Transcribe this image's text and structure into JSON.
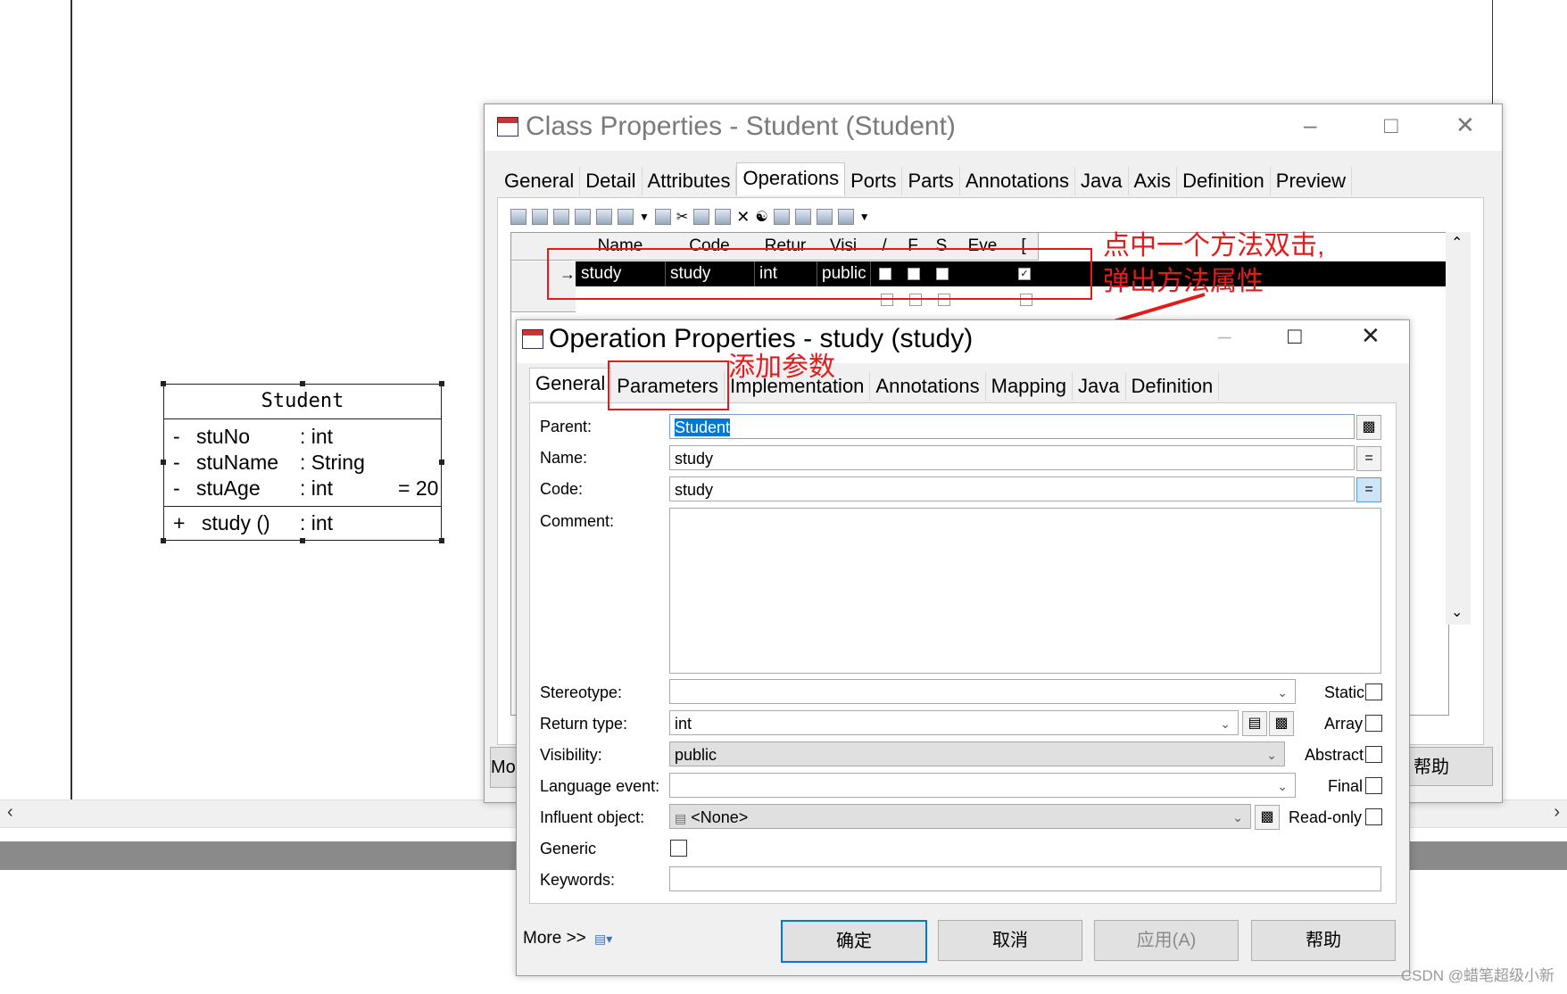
{
  "uml_class": {
    "name": "Student",
    "attributes": [
      {
        "vis": "-",
        "name": "stuNo",
        "type": ": int",
        "default": ""
      },
      {
        "vis": "-",
        "name": "stuName",
        "type": ": String",
        "default": ""
      },
      {
        "vis": "-",
        "name": "stuAge",
        "type": ": int",
        "default": "= 20"
      }
    ],
    "operations": [
      {
        "vis": "+",
        "name": "study ()",
        "type": ": int"
      }
    ]
  },
  "class_window": {
    "title": "Class Properties - Student (Student)",
    "tabs": [
      "General",
      "Detail",
      "Attributes",
      "Operations",
      "Ports",
      "Parts",
      "Annotations",
      "Java",
      "Axis",
      "Definition",
      "Preview"
    ],
    "active_tab": "Operations",
    "columns": [
      "Name",
      "Code",
      "Retur",
      "Visi",
      "/",
      "F",
      "S",
      "Eve",
      "["
    ],
    "row": {
      "name": "study",
      "code": "study",
      "return": "int",
      "visibility": "public"
    },
    "more_label": "Mo",
    "help_label": "帮助"
  },
  "op_window": {
    "title": "Operation Properties - study (study)",
    "tabs": [
      "General",
      "Parameters",
      "Implementation",
      "Annotations",
      "Mapping",
      "Java",
      "Definition"
    ],
    "active_tab": "General",
    "labels": {
      "parent": "Parent:",
      "name": "Name:",
      "code": "Code:",
      "comment": "Comment:",
      "stereotype": "Stereotype:",
      "return_type": "Return type:",
      "visibility": "Visibility:",
      "language_event": "Language event:",
      "influent_object": "Influent object:",
      "generic": "Generic",
      "keywords": "Keywords:"
    },
    "values": {
      "parent": "Student",
      "name": "study",
      "code": "study",
      "comment": "",
      "stereotype": "",
      "return_type": "int",
      "visibility": "public",
      "language_event": "",
      "influent_object": "<None>",
      "keywords": ""
    },
    "checkboxes": {
      "static": "Static",
      "array": "Array",
      "abstract": "Abstract",
      "final": "Final",
      "read_only": "Read-only"
    },
    "buttons": {
      "more": "More >>",
      "ok": "确定",
      "cancel": "取消",
      "apply": "应用(A)",
      "help": "帮助"
    }
  },
  "annotations": {
    "note1_line1": "点中一个方法双击,",
    "note1_line2": "弹出方法属性",
    "note2": "添加参数"
  },
  "watermark": "CSDN @蜡笔超级小新",
  "colors": {
    "annotation_red": "#e31b1b",
    "selection": "#0078d7",
    "selected_row": "#000000"
  }
}
